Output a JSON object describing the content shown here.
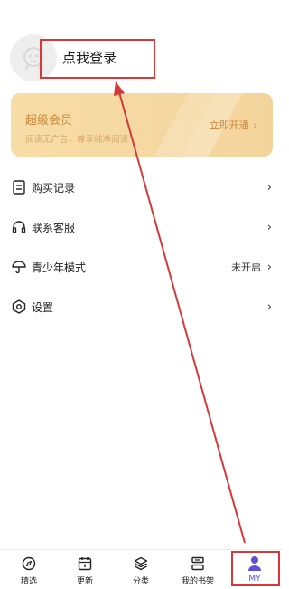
{
  "profile": {
    "login_text": "点我登录"
  },
  "vip": {
    "title": "超级会员",
    "subtitle": "阅读无广告，尊享纯净阅读",
    "open_label": "立即开通",
    "chevron": "›"
  },
  "menu": {
    "items": [
      {
        "icon": "receipt-icon",
        "label": "购买记录",
        "value": "",
        "chevron": "›"
      },
      {
        "icon": "headset-icon",
        "label": "联系客服",
        "value": "",
        "chevron": "›"
      },
      {
        "icon": "umbrella-icon",
        "label": "青少年模式",
        "value": "未开启",
        "chevron": "›"
      },
      {
        "icon": "settings-icon",
        "label": "设置",
        "value": "",
        "chevron": "›"
      }
    ]
  },
  "tabbar": {
    "tabs": [
      {
        "icon": "compass-icon",
        "label": "精选",
        "active": false
      },
      {
        "icon": "calendar-icon",
        "label": "更新",
        "active": false
      },
      {
        "icon": "layers-icon",
        "label": "分类",
        "active": false
      },
      {
        "icon": "bookshelf-icon",
        "label": "我的书架",
        "active": false
      },
      {
        "icon": "user-icon",
        "label": "MY",
        "active": true
      }
    ]
  },
  "colors": {
    "accent": "#5b52d6",
    "annotation": "#d43a3a",
    "vip_text": "#cc8b3e"
  }
}
